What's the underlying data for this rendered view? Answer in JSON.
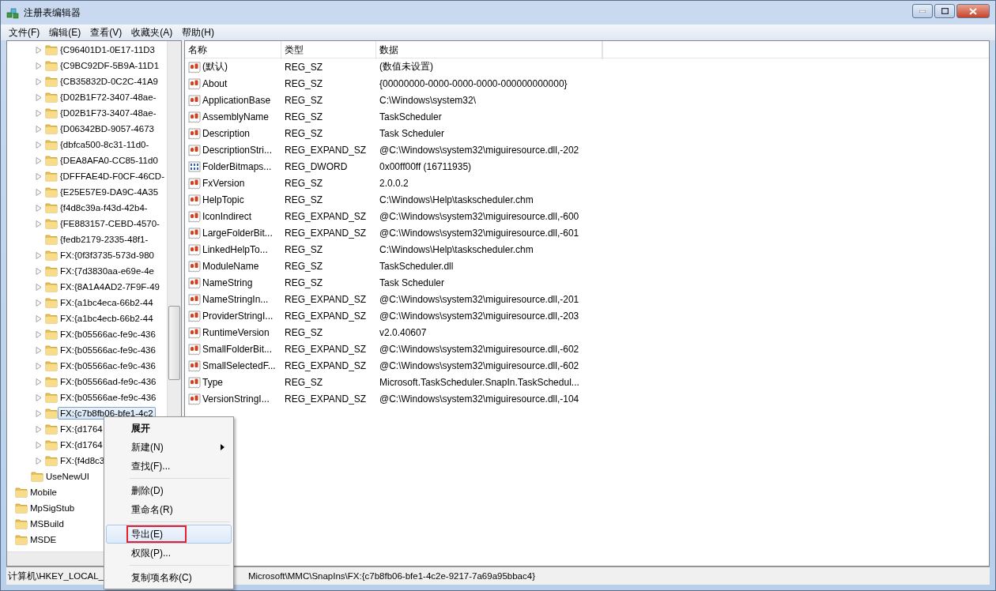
{
  "window": {
    "title": "注册表编辑器"
  },
  "menu_bar": [
    "文件(F)",
    "编辑(E)",
    "查看(V)",
    "收藏夹(A)",
    "帮助(H)"
  ],
  "tree": {
    "keys": [
      {
        "label": "{C96401D1-0E17-11D3",
        "has_children": true,
        "selected": false
      },
      {
        "label": "{C9BC92DF-5B9A-11D1",
        "has_children": true,
        "selected": false
      },
      {
        "label": "{CB35832D-0C2C-41A9",
        "has_children": true,
        "selected": false
      },
      {
        "label": "{D02B1F72-3407-48ae-",
        "has_children": true,
        "selected": false
      },
      {
        "label": "{D02B1F73-3407-48ae-",
        "has_children": true,
        "selected": false
      },
      {
        "label": "{D06342BD-9057-4673",
        "has_children": true,
        "selected": false
      },
      {
        "label": "{dbfca500-8c31-11d0-",
        "has_children": true,
        "selected": false
      },
      {
        "label": "{DEA8AFA0-CC85-11d0",
        "has_children": true,
        "selected": false
      },
      {
        "label": "{DFFFAE4D-F0CF-46CD-",
        "has_children": true,
        "selected": false
      },
      {
        "label": "{E25E57E9-DA9C-4A35",
        "has_children": true,
        "selected": false
      },
      {
        "label": "{f4d8c39a-f43d-42b4-",
        "has_children": true,
        "selected": false
      },
      {
        "label": "{FE883157-CEBD-4570-",
        "has_children": true,
        "selected": false
      },
      {
        "label": "{fedb2179-2335-48f1-",
        "has_children": false,
        "selected": false
      },
      {
        "label": "FX:{0f3f3735-573d-980",
        "has_children": true,
        "selected": false
      },
      {
        "label": "FX:{7d3830aa-e69e-4e",
        "has_children": true,
        "selected": false
      },
      {
        "label": "FX:{8A1A4AD2-7F9F-49",
        "has_children": true,
        "selected": false
      },
      {
        "label": "FX:{a1bc4eca-66b2-44",
        "has_children": true,
        "selected": false
      },
      {
        "label": "FX:{a1bc4ecb-66b2-44",
        "has_children": true,
        "selected": false
      },
      {
        "label": "FX:{b05566ac-fe9c-436",
        "has_children": true,
        "selected": false
      },
      {
        "label": "FX:{b05566ac-fe9c-436",
        "has_children": true,
        "selected": false
      },
      {
        "label": "FX:{b05566ac-fe9c-436",
        "has_children": true,
        "selected": false
      },
      {
        "label": "FX:{b05566ad-fe9c-436",
        "has_children": true,
        "selected": false
      },
      {
        "label": "FX:{b05566ae-fe9c-436",
        "has_children": true,
        "selected": false
      },
      {
        "label": "FX:{c7b8fb06-bfe1-4c2",
        "has_children": true,
        "selected": true
      },
      {
        "label": "FX:{d1764",
        "has_children": true,
        "selected": false
      },
      {
        "label": "FX:{d1764",
        "has_children": true,
        "selected": false
      },
      {
        "label": "FX:{f4d8c3",
        "has_children": true,
        "selected": false
      }
    ],
    "siblings": [
      {
        "label": "UseNewUI",
        "selected": false
      }
    ],
    "root_keys": [
      {
        "label": "Mobile",
        "selected": false
      },
      {
        "label": "MpSigStub",
        "selected": false
      },
      {
        "label": "MSBuild",
        "selected": false
      },
      {
        "label": "MSDE",
        "selected": false
      }
    ]
  },
  "table": {
    "columns": [
      "名称",
      "类型",
      "数据"
    ],
    "rows": [
      {
        "kind": "string",
        "name": "(默认)",
        "type": "REG_SZ",
        "data": "(数值未设置)"
      },
      {
        "kind": "string",
        "name": "About",
        "type": "REG_SZ",
        "data": "{00000000-0000-0000-0000-000000000000}"
      },
      {
        "kind": "string",
        "name": "ApplicationBase",
        "type": "REG_SZ",
        "data": "C:\\Windows\\system32\\"
      },
      {
        "kind": "string",
        "name": "AssemblyName",
        "type": "REG_SZ",
        "data": "TaskScheduler"
      },
      {
        "kind": "string",
        "name": "Description",
        "type": "REG_SZ",
        "data": "Task Scheduler"
      },
      {
        "kind": "string",
        "name": "DescriptionStri...",
        "type": "REG_EXPAND_SZ",
        "data": "@C:\\Windows\\system32\\miguiresource.dll,-202"
      },
      {
        "kind": "binary",
        "name": "FolderBitmaps...",
        "type": "REG_DWORD",
        "data": "0x00ff00ff (16711935)"
      },
      {
        "kind": "string",
        "name": "FxVersion",
        "type": "REG_SZ",
        "data": "2.0.0.2"
      },
      {
        "kind": "string",
        "name": "HelpTopic",
        "type": "REG_SZ",
        "data": "C:\\Windows\\Help\\taskscheduler.chm"
      },
      {
        "kind": "string",
        "name": "IconIndirect",
        "type": "REG_EXPAND_SZ",
        "data": "@C:\\Windows\\system32\\miguiresource.dll,-600"
      },
      {
        "kind": "string",
        "name": "LargeFolderBit...",
        "type": "REG_EXPAND_SZ",
        "data": "@C:\\Windows\\system32\\miguiresource.dll,-601"
      },
      {
        "kind": "string",
        "name": "LinkedHelpTo...",
        "type": "REG_SZ",
        "data": "C:\\Windows\\Help\\taskscheduler.chm"
      },
      {
        "kind": "string",
        "name": "ModuleName",
        "type": "REG_SZ",
        "data": "TaskScheduler.dll"
      },
      {
        "kind": "string",
        "name": "NameString",
        "type": "REG_SZ",
        "data": "Task Scheduler"
      },
      {
        "kind": "string",
        "name": "NameStringIn...",
        "type": "REG_EXPAND_SZ",
        "data": "@C:\\Windows\\system32\\miguiresource.dll,-201"
      },
      {
        "kind": "string",
        "name": "ProviderStringI...",
        "type": "REG_EXPAND_SZ",
        "data": "@C:\\Windows\\system32\\miguiresource.dll,-203"
      },
      {
        "kind": "string",
        "name": "RuntimeVersion",
        "type": "REG_SZ",
        "data": "v2.0.40607"
      },
      {
        "kind": "string",
        "name": "SmallFolderBit...",
        "type": "REG_EXPAND_SZ",
        "data": "@C:\\Windows\\system32\\miguiresource.dll,-602"
      },
      {
        "kind": "string",
        "name": "SmallSelectedF...",
        "type": "REG_EXPAND_SZ",
        "data": "@C:\\Windows\\system32\\miguiresource.dll,-602"
      },
      {
        "kind": "string",
        "name": "Type",
        "type": "REG_SZ",
        "data": "Microsoft.TaskScheduler.SnapIn.TaskSchedul..."
      },
      {
        "kind": "string",
        "name": "VersionStringI...",
        "type": "REG_EXPAND_SZ",
        "data": "@C:\\Windows\\system32\\miguiresource.dll,-104"
      }
    ]
  },
  "context_menu": [
    {
      "kind": "item",
      "label": "展开",
      "bold": true,
      "submenu": false,
      "highlighted": false,
      "annotated": false
    },
    {
      "kind": "item",
      "label": "新建(N)",
      "bold": false,
      "submenu": true,
      "highlighted": false,
      "annotated": false
    },
    {
      "kind": "item",
      "label": "查找(F)...",
      "bold": false,
      "submenu": false,
      "highlighted": false,
      "annotated": false
    },
    {
      "kind": "separator"
    },
    {
      "kind": "item",
      "label": "删除(D)",
      "bold": false,
      "submenu": false,
      "highlighted": false,
      "annotated": false
    },
    {
      "kind": "item",
      "label": "重命名(R)",
      "bold": false,
      "submenu": false,
      "highlighted": false,
      "annotated": false
    },
    {
      "kind": "separator"
    },
    {
      "kind": "item",
      "label": "导出(E)",
      "bold": false,
      "submenu": false,
      "highlighted": true,
      "annotated": true
    },
    {
      "kind": "item",
      "label": "权限(P)...",
      "bold": false,
      "submenu": false,
      "highlighted": false,
      "annotated": false
    },
    {
      "kind": "separator"
    },
    {
      "kind": "item",
      "label": "复制项名称(C)",
      "bold": false,
      "submenu": false,
      "highlighted": false,
      "annotated": false
    }
  ],
  "status_bar": {
    "path_start": "计算机\\HKEY_LOCAL_",
    "path_end": "Microsoft\\MMC\\SnapIns\\FX:{c7b8fb06-bfe1-4c2e-9217-7a69a95bbac4}"
  }
}
